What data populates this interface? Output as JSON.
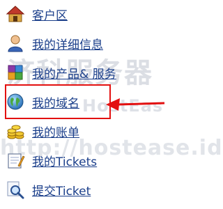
{
  "watermark": {
    "line1": "济科服务器",
    "line2": "HostEas",
    "line3": "http://hostease.id"
  },
  "menu": {
    "items": [
      {
        "label": "客户区",
        "icon": "house-icon"
      },
      {
        "label": "我的详细信息",
        "icon": "user-icon"
      },
      {
        "label": "我的产品& 服务",
        "icon": "products-icon"
      },
      {
        "label": "我的域名",
        "icon": "globe-icon"
      },
      {
        "label": "我的账单",
        "icon": "coins-icon"
      },
      {
        "label": "我的Tickets",
        "icon": "notepad-icon"
      },
      {
        "label": "提交Ticket",
        "icon": "magnifier-icon"
      }
    ]
  },
  "annotation": {
    "highlight_color": "#e31010"
  },
  "colors": {
    "link": "#1a3e8a"
  }
}
